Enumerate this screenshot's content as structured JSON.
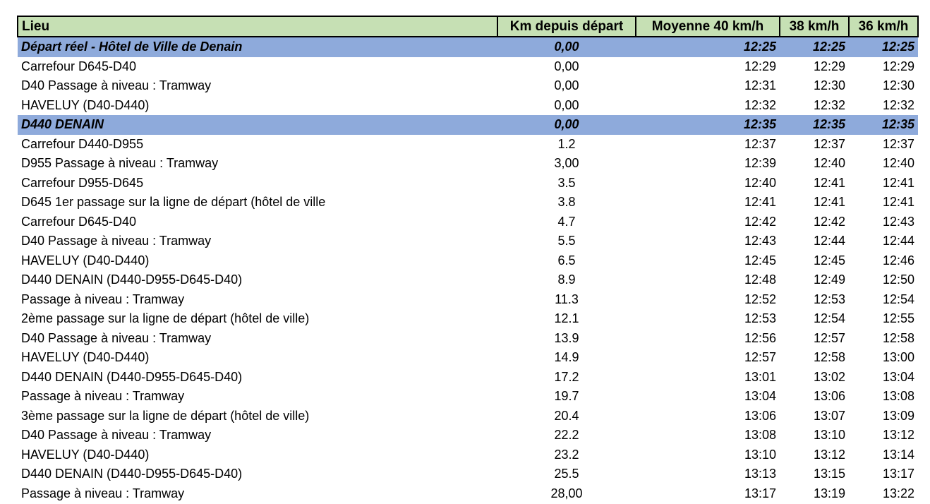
{
  "headers": {
    "lieu": "Lieu",
    "km": "Km depuis départ",
    "s40": "Moyenne 40 km/h",
    "s38": "38 km/h",
    "s36": "36 km/h"
  },
  "colors": {
    "header_bg": "#c6e0b4",
    "highlight_bg": "#8eaadb"
  },
  "rows": [
    {
      "lieu": "Départ réel - Hôtel de Ville de Denain",
      "km": "0,00",
      "t40": "12:25",
      "t38": "12:25",
      "t36": "12:25",
      "highlight": true
    },
    {
      "lieu": "Carrefour D645-D40",
      "km": "0,00",
      "t40": "12:29",
      "t38": "12:29",
      "t36": "12:29",
      "highlight": false
    },
    {
      "lieu": "D40 Passage à niveau : Tramway",
      "km": "0,00",
      "t40": "12:31",
      "t38": "12:30",
      "t36": "12:30",
      "highlight": false
    },
    {
      "lieu": "HAVELUY (D40-D440)",
      "km": "0,00",
      "t40": "12:32",
      "t38": "12:32",
      "t36": "12:32",
      "highlight": false
    },
    {
      "lieu": "D440 DENAIN",
      "km": "0,00",
      "t40": "12:35",
      "t38": "12:35",
      "t36": "12:35",
      "highlight": true
    },
    {
      "lieu": "Carrefour D440-D955",
      "km": "1.2",
      "t40": "12:37",
      "t38": "12:37",
      "t36": "12:37",
      "highlight": false
    },
    {
      "lieu": "D955 Passage à niveau : Tramway",
      "km": "3,00",
      "t40": "12:39",
      "t38": "12:40",
      "t36": "12:40",
      "highlight": false
    },
    {
      "lieu": "Carrefour D955-D645",
      "km": "3.5",
      "t40": "12:40",
      "t38": "12:41",
      "t36": "12:41",
      "highlight": false
    },
    {
      "lieu": "D645 1er passage sur la ligne de départ (hôtel de ville",
      "km": "3.8",
      "t40": "12:41",
      "t38": "12:41",
      "t36": "12:41",
      "highlight": false
    },
    {
      "lieu": "Carrefour D645-D40",
      "km": "4.7",
      "t40": "12:42",
      "t38": "12:42",
      "t36": "12:43",
      "highlight": false
    },
    {
      "lieu": "D40 Passage à niveau : Tramway",
      "km": "5.5",
      "t40": "12:43",
      "t38": "12:44",
      "t36": "12:44",
      "highlight": false
    },
    {
      "lieu": "HAVELUY (D40-D440)",
      "km": "6.5",
      "t40": "12:45",
      "t38": "12:45",
      "t36": "12:46",
      "highlight": false
    },
    {
      "lieu": "D440 DENAIN (D440-D955-D645-D40)",
      "km": "8.9",
      "t40": "12:48",
      "t38": "12:49",
      "t36": "12:50",
      "highlight": false
    },
    {
      "lieu": "Passage à niveau : Tramway",
      "km": "11.3",
      "t40": "12:52",
      "t38": "12:53",
      "t36": "12:54",
      "highlight": false
    },
    {
      "lieu": "2ème passage sur la ligne de départ (hôtel de ville)",
      "km": "12.1",
      "t40": "12:53",
      "t38": "12:54",
      "t36": "12:55",
      "highlight": false
    },
    {
      "lieu": "D40 Passage à niveau : Tramway",
      "km": "13.9",
      "t40": "12:56",
      "t38": "12:57",
      "t36": "12:58",
      "highlight": false
    },
    {
      "lieu": "HAVELUY (D40-D440)",
      "km": "14.9",
      "t40": "12:57",
      "t38": "12:58",
      "t36": "13:00",
      "highlight": false
    },
    {
      "lieu": "D440 DENAIN (D440-D955-D645-D40)",
      "km": "17.2",
      "t40": "13:01",
      "t38": "13:02",
      "t36": "13:04",
      "highlight": false
    },
    {
      "lieu": "Passage à niveau : Tramway",
      "km": "19.7",
      "t40": "13:04",
      "t38": "13:06",
      "t36": "13:08",
      "highlight": false
    },
    {
      "lieu": "3ème passage sur la ligne de départ (hôtel de ville)",
      "km": "20.4",
      "t40": "13:06",
      "t38": "13:07",
      "t36": "13:09",
      "highlight": false
    },
    {
      "lieu": "D40 Passage à niveau : Tramway",
      "km": "22.2",
      "t40": "13:08",
      "t38": "13:10",
      "t36": "13:12",
      "highlight": false
    },
    {
      "lieu": "HAVELUY (D40-D440)",
      "km": "23.2",
      "t40": "13:10",
      "t38": "13:12",
      "t36": "13:14",
      "highlight": false
    },
    {
      "lieu": "D440 DENAIN (D440-D955-D645-D40)",
      "km": "25.5",
      "t40": "13:13",
      "t38": "13:15",
      "t36": "13:17",
      "highlight": false
    },
    {
      "lieu": "Passage à niveau : Tramway",
      "km": "28,00",
      "t40": "13:17",
      "t38": "13:19",
      "t36": "13:22",
      "highlight": false
    }
  ]
}
